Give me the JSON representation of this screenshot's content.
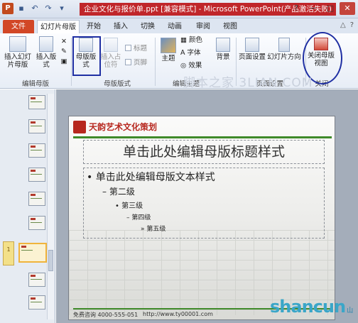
{
  "window": {
    "title": "企业文化与报价单.ppt [兼容模式] - Microsoft PowerPoint(产品激活失败)",
    "controls": [
      "?",
      "−",
      "□",
      "✕"
    ]
  },
  "qat_icons": [
    "powerpoint-icon",
    "save-icon",
    "undo-icon",
    "redo-icon",
    "customize-icon"
  ],
  "tabs": [
    {
      "label": "文件"
    },
    {
      "label": "幻灯片母版"
    },
    {
      "label": "开始"
    },
    {
      "label": "插入"
    },
    {
      "label": "切换"
    },
    {
      "label": "动画"
    },
    {
      "label": "审阅"
    },
    {
      "label": "视图"
    }
  ],
  "ribbon": {
    "insert_master": "插入幻灯片母版",
    "insert_layout": "插入版式",
    "master_layout": "母版版式",
    "insert_placeholder": "插入占位符",
    "chk_title": "标题",
    "chk_footer": "页脚",
    "themes": "主题",
    "colors": "颜色",
    "fonts": "字体",
    "effects": "效果",
    "background": "背景",
    "page_setup": "页面设置",
    "slide_orientation": "幻灯片方向",
    "close_master": "关闭母版视图",
    "groups": {
      "edit_master": "编辑母版",
      "master_layout": "母版版式",
      "edit_theme": "编辑主题",
      "page_setup": "页面设置",
      "close": "关闭"
    }
  },
  "watermark": "脚本之家 3LIAN.COM",
  "left_panel": {
    "selected_marker": "1",
    "thumb_count": 13
  },
  "slide": {
    "brand": "天韵艺术文化策划",
    "title": "单击此处编辑母版标题样式",
    "levels": [
      "• 单击此处编辑母版文本样式",
      "– 第二级",
      "• 第三级",
      "– 第四级",
      "» 第五级"
    ],
    "footer_left": "免费咨询 4000-555-051",
    "footer_right": "http://www.ty00001.com"
  },
  "brand_watermark": {
    "text": "shancun",
    "sub": "山村"
  }
}
